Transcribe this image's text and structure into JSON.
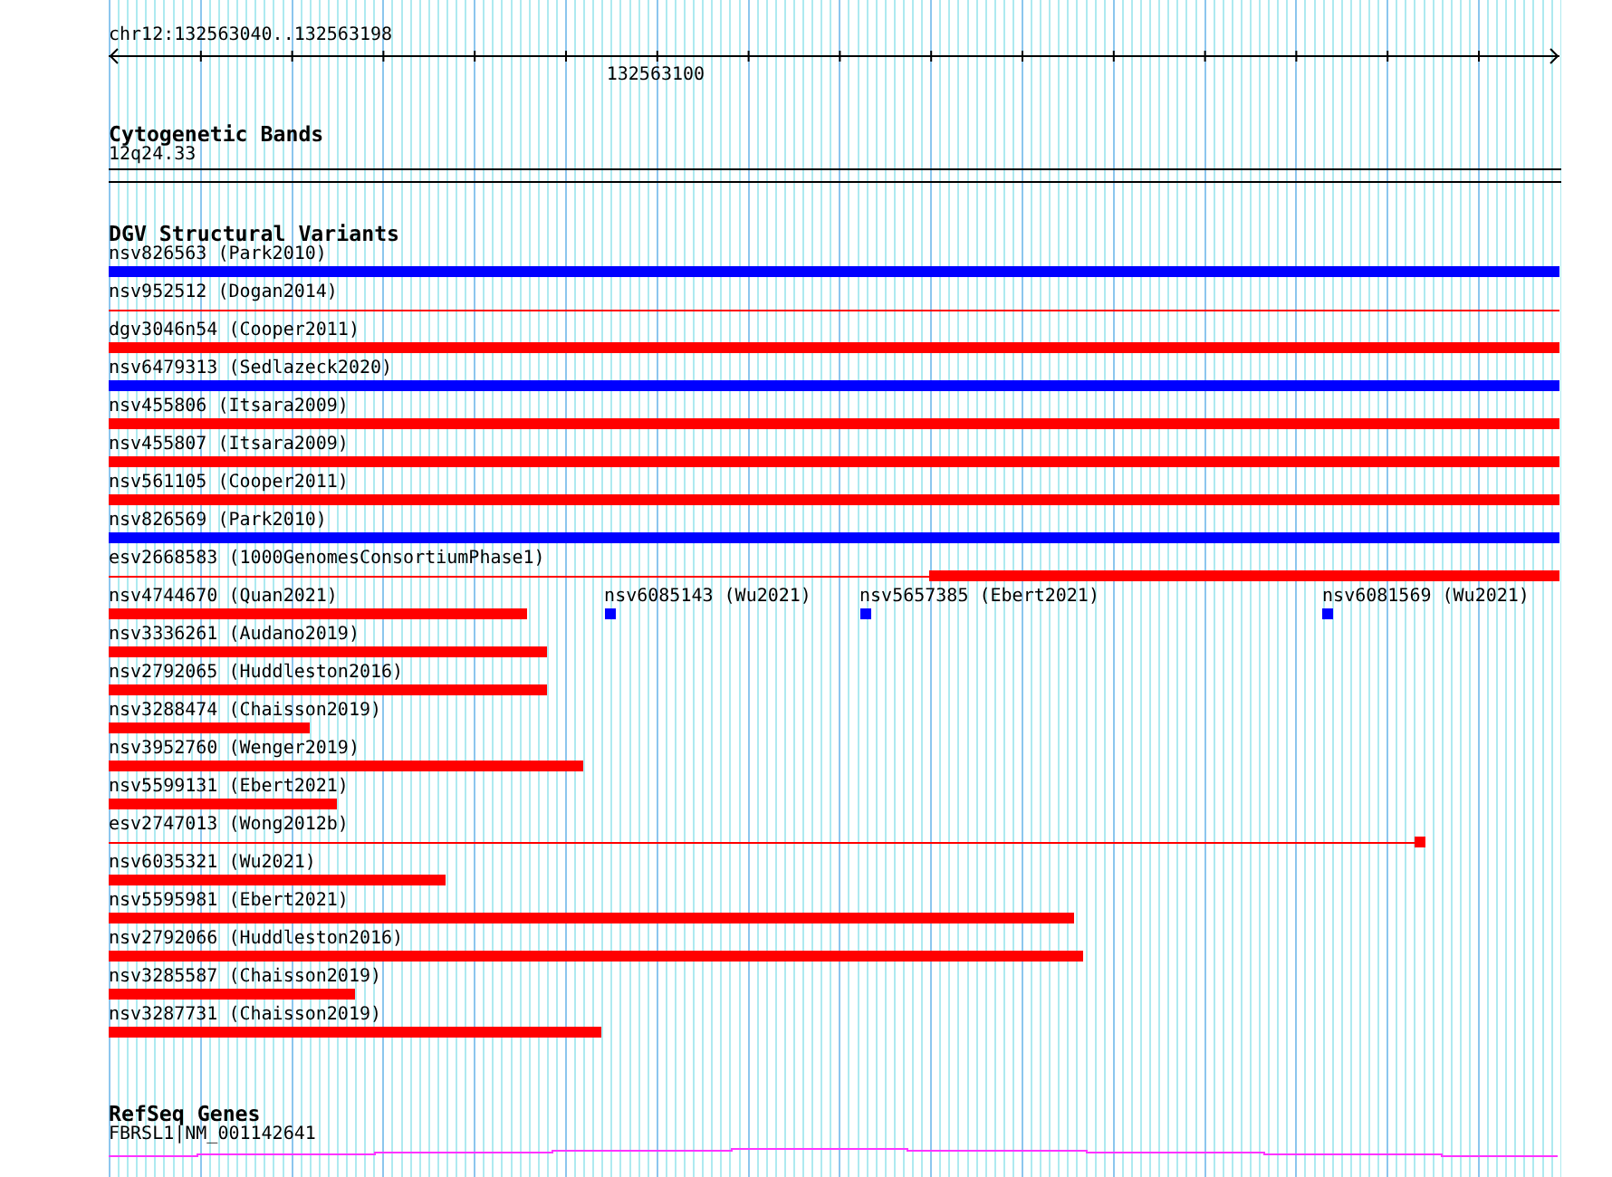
{
  "ruler": {
    "location": "chr12:132563040..132563198",
    "ticks": [
      {
        "label": "132563100",
        "level": 0.377
      }
    ]
  },
  "cytobands": {
    "title": "Cytogenetic Bands",
    "bands": [
      {
        "label": "12q24.33"
      }
    ]
  },
  "dgv": {
    "title": "DGV Structural Variants",
    "rows": [
      {
        "features": [
          {
            "label": "nsv826563 (Park2010)",
            "color": "#0000ff",
            "parts": [
              {
                "kind": "block",
                "level": 1
              }
            ]
          }
        ]
      },
      {
        "features": [
          {
            "label": "nsv952512 (Dogan2014)",
            "color": "#ff0000",
            "parts": [
              {
                "kind": "line",
                "level": 1
              }
            ]
          }
        ]
      },
      {
        "features": [
          {
            "label": "dgv3046n54 (Cooper2011)",
            "color": "#ff0000",
            "parts": [
              {
                "kind": "block",
                "level": 1
              }
            ]
          }
        ]
      },
      {
        "features": [
          {
            "label": "nsv6479313 (Sedlazeck2020)",
            "color": "#0000ff",
            "parts": [
              {
                "kind": "block",
                "level": 1
              }
            ]
          }
        ]
      },
      {
        "features": [
          {
            "label": "nsv455806 (Itsara2009)",
            "color": "#ff0000",
            "parts": [
              {
                "kind": "block",
                "level": 1
              }
            ]
          }
        ]
      },
      {
        "features": [
          {
            "label": "nsv455807 (Itsara2009)",
            "color": "#ff0000",
            "parts": [
              {
                "kind": "block",
                "level": 1
              }
            ]
          }
        ]
      },
      {
        "features": [
          {
            "label": "nsv561105 (Cooper2011)",
            "color": "#ff0000",
            "parts": [
              {
                "kind": "block",
                "level": 1
              }
            ]
          }
        ]
      },
      {
        "features": [
          {
            "label": "nsv826569 (Park2010)",
            "color": "#0000ff",
            "parts": [
              {
                "kind": "block",
                "level": 1
              }
            ]
          }
        ]
      },
      {
        "features": [
          {
            "label": "esv2668583 (1000GenomesConsortiumPhase1)",
            "color": "#ff0000",
            "parts": [
              {
                "kind": "line",
                "level": 0.566
              },
              {
                "kind": "block",
                "level": 1
              }
            ]
          }
        ]
      },
      {
        "features": [
          {
            "label": "nsv4744670 (Quan2021)",
            "color": "#ff0000",
            "parts": [
              {
                "kind": "block",
                "level": 0.288
              }
            ]
          },
          {
            "label": "nsv6085143 (Wu2021)",
            "color": "#0000ff",
            "parts": [
              {
                "kind": "point",
                "level": 0.349
              }
            ]
          },
          {
            "label": "nsv5657385 (Ebert2021)",
            "color": "#0000ff",
            "parts": [
              {
                "kind": "point",
                "level": 0.525
              }
            ]
          },
          {
            "label": "nsv6081569 (Wu2021)",
            "color": "#0000ff",
            "parts": [
              {
                "kind": "point",
                "level": 0.844
              }
            ]
          }
        ]
      },
      {
        "features": [
          {
            "label": "nsv3336261 (Audano2019)",
            "color": "#ff0000",
            "parts": [
              {
                "kind": "block",
                "level": 0.302
              }
            ]
          }
        ]
      },
      {
        "features": [
          {
            "label": "nsv2792065 (Huddleston2016)",
            "color": "#ff0000",
            "parts": [
              {
                "kind": "block",
                "level": 0.302
              }
            ]
          }
        ]
      },
      {
        "features": [
          {
            "label": "nsv3288474 (Chaisson2019)",
            "color": "#ff0000",
            "parts": [
              {
                "kind": "block",
                "level": 0.139
              }
            ]
          }
        ]
      },
      {
        "features": [
          {
            "label": "nsv3952760 (Wenger2019)",
            "color": "#ff0000",
            "parts": [
              {
                "kind": "block",
                "level": 0.327
              }
            ]
          }
        ]
      },
      {
        "features": [
          {
            "label": "nsv5599131 (Ebert2021)",
            "color": "#ff0000",
            "parts": [
              {
                "kind": "block",
                "level": 0.157
              }
            ]
          }
        ]
      },
      {
        "features": [
          {
            "label": "esv2747013 (Wong2012b)",
            "color": "#ff0000",
            "parts": [
              {
                "kind": "line",
                "level": 0.9
              },
              {
                "kind": "block",
                "level": 0.9075
              }
            ]
          }
        ]
      },
      {
        "features": [
          {
            "label": "nsv6035321 (Wu2021)",
            "color": "#ff0000",
            "parts": [
              {
                "kind": "block",
                "level": 0.232
              }
            ]
          }
        ]
      },
      {
        "features": [
          {
            "label": "nsv5595981 (Ebert2021)",
            "color": "#ff0000",
            "parts": [
              {
                "kind": "block",
                "level": 0.665
              }
            ]
          }
        ]
      },
      {
        "features": [
          {
            "label": "nsv2792066 (Huddleston2016)",
            "color": "#ff0000",
            "parts": [
              {
                "kind": "block",
                "level": 0.672
              }
            ]
          }
        ]
      },
      {
        "features": [
          {
            "label": "nsv3285587 (Chaisson2019)",
            "color": "#ff0000",
            "parts": [
              {
                "kind": "block",
                "level": 0.17
              }
            ]
          }
        ]
      },
      {
        "features": [
          {
            "label": "nsv3287731 (Chaisson2019)",
            "color": "#ff0000",
            "parts": [
              {
                "kind": "block",
                "level": 0.34
              }
            ]
          }
        ]
      }
    ]
  },
  "refseq": {
    "title": "RefSeq Genes",
    "genes": [
      {
        "label": "FBRSL1|NM_001142641"
      }
    ]
  }
}
